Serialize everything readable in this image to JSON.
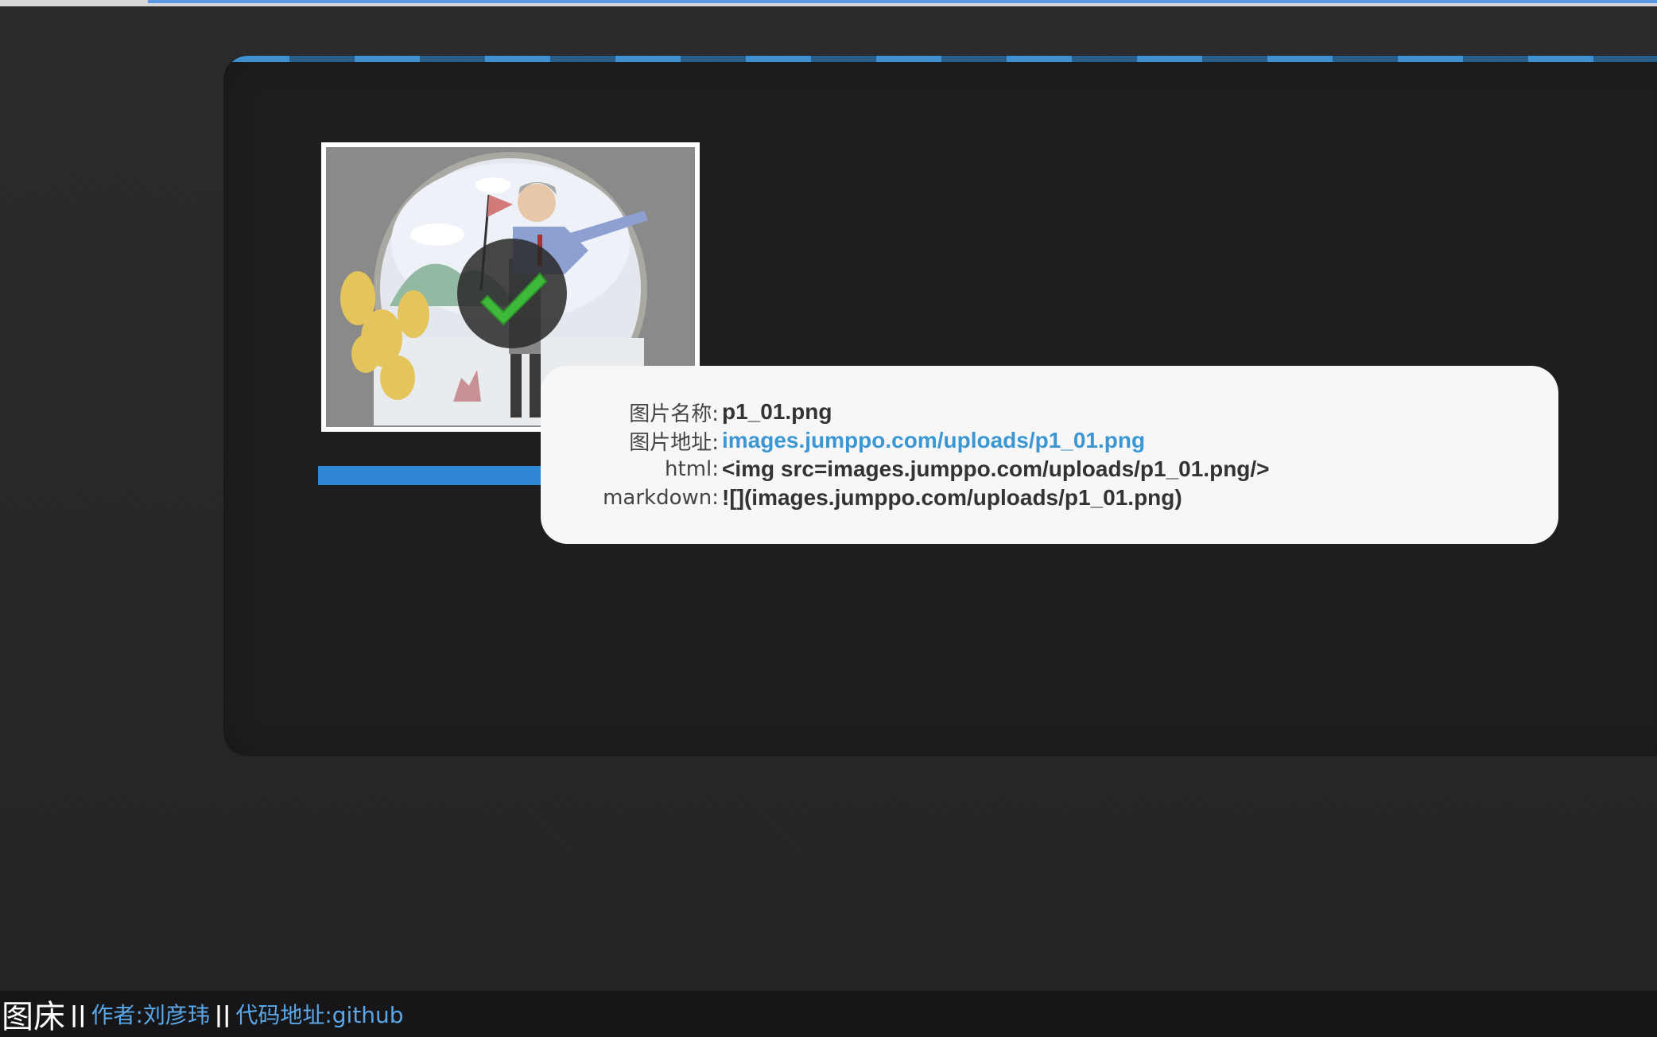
{
  "panel": {
    "result": {
      "name_label": "图片名称:",
      "name_value": "p1_01.png",
      "url_label": "图片地址:",
      "url_value": "images.jumppo.com/uploads/p1_01.png",
      "html_label": "html:",
      "html_value": "<img src=images.jumppo.com/uploads/p1_01.png/>",
      "markdown_label": "markdown:",
      "markdown_value": "![](images.jumppo.com/uploads/p1_01.png)"
    },
    "upload_progress": 1.0
  },
  "footer": {
    "brand": "图床",
    "separator": "||",
    "author": "作者:刘彦玮",
    "code_link": "代码地址:github"
  },
  "colors": {
    "accent": "#2f86d6",
    "link": "#3a97d4",
    "success": "#3fb93a"
  },
  "icons": {
    "check": "check-icon"
  }
}
